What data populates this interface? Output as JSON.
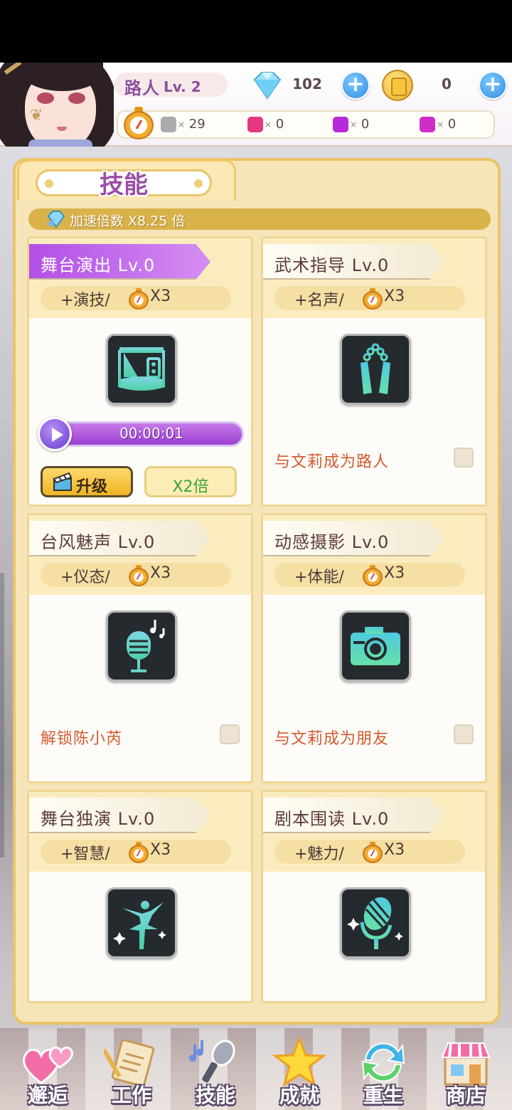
{
  "player": {
    "name": "路人",
    "level": "Lv. 2"
  },
  "currencies": {
    "gems": "102",
    "coins": "0"
  },
  "resources": [
    {
      "icon": "gray-block-icon",
      "color": "#a9abad",
      "value": "29"
    },
    {
      "icon": "pink-block-icon",
      "color": "#e4387f",
      "value": "0"
    },
    {
      "icon": "purple-block-icon",
      "color": "#b62ad8",
      "value": "0"
    },
    {
      "icon": "magenta-block-icon",
      "color": "#cf2cc8",
      "value": "0"
    }
  ],
  "resource_x": "×",
  "panel": {
    "title": "技能",
    "speed": "加速倍数 X8.25 倍"
  },
  "skills": [
    {
      "title": "舞台演出 Lv.0",
      "stat": "+演技/",
      "mult": "X3",
      "icon": "stage-icon",
      "active": true,
      "progress": "00:00:01",
      "progress_fraction": 1.0,
      "upgrade": "升级",
      "boost": "X2倍"
    },
    {
      "title": "武术指导 Lv.0",
      "stat": "+名声/",
      "mult": "X3",
      "icon": "nunchaku-icon",
      "unlock": "与文莉成为路人"
    },
    {
      "title": "台风魅声 Lv.0",
      "stat": "+仪态/",
      "mult": "X3",
      "icon": "microphone-icon",
      "unlock": "解锁陈小芮"
    },
    {
      "title": "动感摄影 Lv.0",
      "stat": "+体能/",
      "mult": "X3",
      "icon": "camera-icon",
      "unlock": "与文莉成为朋友"
    },
    {
      "title": "舞台独演 Lv.0",
      "stat": "+智慧/",
      "mult": "X3",
      "icon": "ballet-dancer-icon"
    },
    {
      "title": "剧本围读 Lv.0",
      "stat": "+魅力/",
      "mult": "X3",
      "icon": "retro-microphone-icon"
    }
  ],
  "nav": [
    {
      "label": "邂逅",
      "icon": "hearts-icon"
    },
    {
      "label": "工作",
      "icon": "clipboard-icon"
    },
    {
      "label": "技能",
      "icon": "music-microphone-icon"
    },
    {
      "label": "成就",
      "icon": "star-icon"
    },
    {
      "label": "重生",
      "icon": "refresh-icon"
    },
    {
      "label": "商店",
      "icon": "shop-icon"
    }
  ],
  "colors": {
    "accent": "#9b4ea6",
    "panel": "#f6e5b8",
    "progress": "#b45ae0",
    "unlock_text": "#d25a2e"
  }
}
